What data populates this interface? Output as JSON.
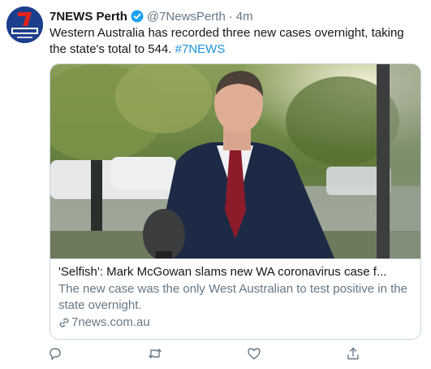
{
  "tweet": {
    "author_name": "7NEWS Perth",
    "handle": "@7NewsPerth",
    "separator": "·",
    "time": "4m",
    "text": "Western Australia has recorded three new cases overnight, taking the state's total to 544.",
    "hashtag": "#7NEWS",
    "avatar_logo_text": "7NEWS PERTH"
  },
  "card": {
    "title": "'Selfish': Mark McGowan slams new WA coronavirus case f...",
    "description": "The new case was the only West Australian to test positive in the state overnight.",
    "domain": "7news.com.au"
  },
  "actions": {
    "reply_icon": "reply-icon",
    "retweet_icon": "retweet-icon",
    "like_icon": "heart-icon",
    "share_icon": "share-icon"
  },
  "colors": {
    "accent": "#1b95e0",
    "secondary_text": "#657786",
    "border": "#ccd6dd",
    "verified": "#1da1f2",
    "avatar_bg": "#1c3f8c"
  }
}
